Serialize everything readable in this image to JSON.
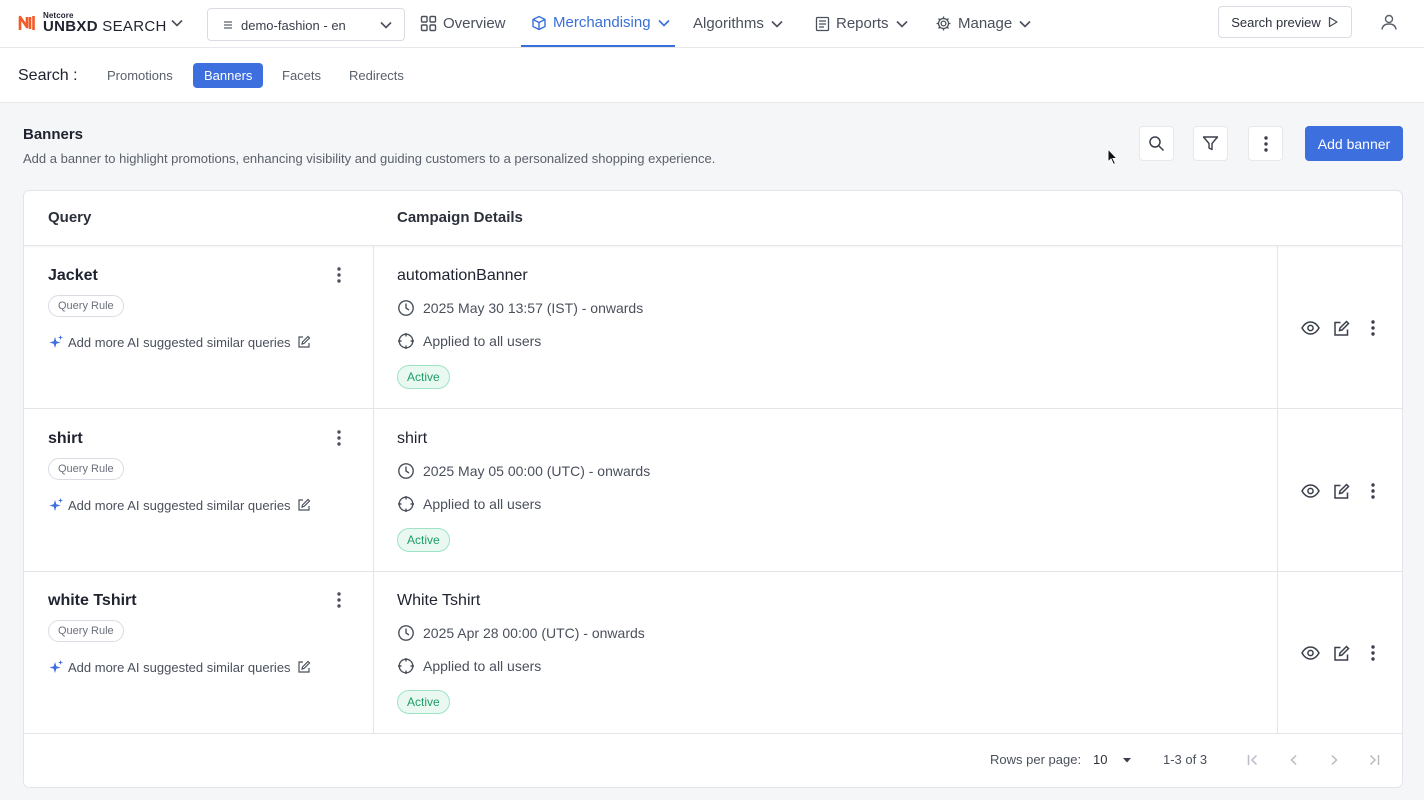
{
  "brand": {
    "top": "Netcore",
    "name_bold": "UNBXD",
    "name_rest": " SEARCH",
    "accent": "#f15a29"
  },
  "site_selector": {
    "value": "demo-fashion - en"
  },
  "nav": {
    "items": [
      {
        "label": "Overview",
        "icon": "grid-icon"
      },
      {
        "label": "Merchandising",
        "icon": "cube-icon"
      },
      {
        "label": "Algorithms"
      },
      {
        "label": "Reports",
        "icon": "report-icon"
      },
      {
        "label": "Manage",
        "icon": "gear-icon"
      }
    ],
    "search_preview": "Search preview"
  },
  "subnav": {
    "label": "Search :",
    "tabs": [
      "Promotions",
      "Banners",
      "Facets",
      "Redirects"
    ],
    "active": "Banners"
  },
  "header": {
    "title": "Banners",
    "description": "Add a banner to highlight promotions, enhancing visibility and guiding customers to a personalized shopping experience.",
    "add_button": "Add banner"
  },
  "table": {
    "columns": [
      "Query",
      "Campaign Details"
    ],
    "rows": [
      {
        "query": "Jacket",
        "chip": "Query Rule",
        "ai_text": "Add more AI suggested similar queries",
        "campaign": "automationBanner",
        "date": "2025 May 30 13:57 (IST) - onwards",
        "audience": "Applied to all users",
        "status": "Active"
      },
      {
        "query": "shirt",
        "chip": "Query Rule",
        "ai_text": "Add more AI suggested similar queries",
        "campaign": "shirt",
        "date": "2025 May 05 00:00 (UTC) - onwards",
        "audience": "Applied to all users",
        "status": "Active"
      },
      {
        "query": "white Tshirt",
        "chip": "Query Rule",
        "ai_text": "Add more AI suggested similar queries",
        "campaign": "White Tshirt",
        "date": "2025 Apr 28 00:00 (UTC) - onwards",
        "audience": "Applied to all users",
        "status": "Active"
      }
    ]
  },
  "pagination": {
    "rows_per_page_label": "Rows per page:",
    "rows_per_page": "10",
    "range": "1-3 of 3"
  },
  "colors": {
    "primary": "#3d6fde",
    "active_green": "#1f9c66"
  }
}
